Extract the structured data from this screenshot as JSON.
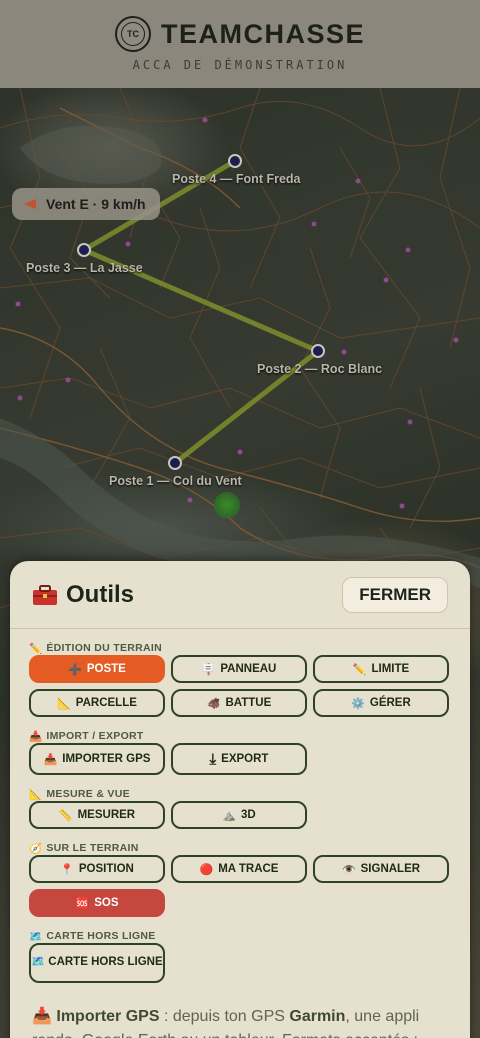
{
  "header": {
    "title": "TEAMCHASSE",
    "subtitle": "ACCA DE DÉMONSTRATION",
    "logo_text": "TC"
  },
  "wind": {
    "label": "Vent E · 9 km/h",
    "icon": "wind-arrow-icon"
  },
  "route": {
    "color": "#7a8a2c"
  },
  "postes": [
    {
      "label": "Poste 4 — Font Freda"
    },
    {
      "label": "Poste 3 — La Jasse"
    },
    {
      "label": "Poste 2 — Roc Blanc"
    },
    {
      "label": "Poste 1 — Col du Vent"
    }
  ],
  "panel": {
    "title": "Outils",
    "title_icon": "toolbox-icon",
    "close_label": "FERMER",
    "sections": {
      "edition": {
        "title": "ÉDITION DU TERRAIN",
        "icon": "✏️",
        "buttons": [
          {
            "icon": "➕",
            "label": "POSTE"
          },
          {
            "icon": "🪧",
            "label": "PANNEAU"
          },
          {
            "icon": "✏️",
            "label": "LIMITE"
          },
          {
            "icon": "📐",
            "label": "PARCELLE"
          },
          {
            "icon": "🐗",
            "label": "BATTUE"
          },
          {
            "icon": "⚙️",
            "label": "GÉRER"
          }
        ]
      },
      "import": {
        "title": "IMPORT / EXPORT",
        "icon": "📥",
        "buttons": [
          {
            "icon": "📥",
            "label": "IMPORTER GPS"
          },
          {
            "icon": "⤓",
            "label": "EXPORT"
          }
        ]
      },
      "mesure": {
        "title": "MESURE & VUE",
        "icon": "📐",
        "buttons": [
          {
            "icon": "📏",
            "label": "MESURER"
          },
          {
            "icon": "⛰️",
            "label": "3D"
          }
        ]
      },
      "terrain": {
        "title": "SUR LE TERRAIN",
        "icon": "🧭",
        "buttons": [
          {
            "icon": "📍",
            "label": "POSITION"
          },
          {
            "icon": "🔴",
            "label": "MA TRACE"
          },
          {
            "icon": "👁️",
            "label": "SIGNALER"
          },
          {
            "icon": "🆘",
            "label": "SOS"
          }
        ]
      },
      "offline": {
        "title": "CARTE HORS LIGNE",
        "icon": "🗺️",
        "buttons": [
          {
            "icon": "🗺️",
            "label": "CARTE HORS LIGNE"
          }
        ]
      }
    },
    "info": {
      "icon": "📥",
      "strong1": "Importer GPS",
      "text1": " : depuis ton GPS ",
      "strong2": "Garmin",
      "text2": ", une appli rando, Google Earth ou un tableur. Formats acceptés :"
    }
  },
  "colors": {
    "accent": "#e55b24",
    "sos": "#c6473d",
    "button_border": "#2f4327",
    "panel_bg": "#e6e0ce",
    "header_bg": "#8b877c"
  }
}
